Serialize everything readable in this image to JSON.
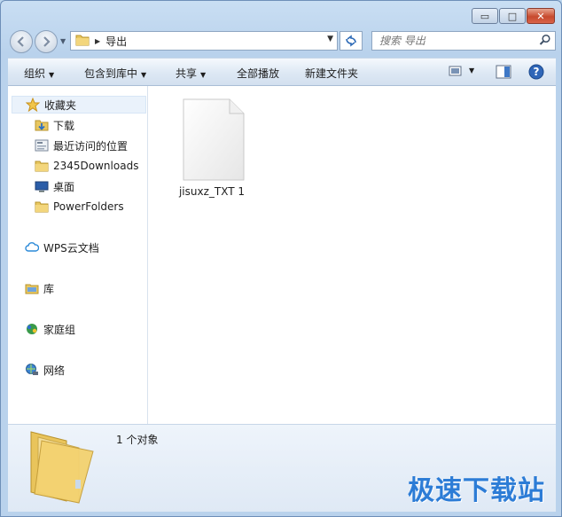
{
  "window": {
    "caption_buttons": {
      "minimize": "▭",
      "maximize": "□",
      "close": "✕"
    }
  },
  "nav": {
    "back_icon": "back-arrow-icon",
    "forward_icon": "forward-arrow-icon",
    "address": {
      "crumbs": [
        "导出"
      ]
    },
    "search": {
      "placeholder": "搜索 导出"
    }
  },
  "toolbar": {
    "organize": "组织",
    "include_in_library": "包含到库中",
    "share": "共享",
    "play_all": "全部播放",
    "new_folder": "新建文件夹"
  },
  "sidebar": {
    "favorites_label": "收藏夹",
    "favorites": [
      {
        "label": "下载",
        "icon": "download-folder-icon"
      },
      {
        "label": "最近访问的位置",
        "icon": "recent-places-icon"
      },
      {
        "label": "2345Downloads",
        "icon": "folder-icon"
      },
      {
        "label": "桌面",
        "icon": "desktop-icon"
      },
      {
        "label": "PowerFolders",
        "icon": "folder-icon"
      }
    ],
    "wps_cloud": "WPS云文档",
    "libraries": "库",
    "homegroup": "家庭组",
    "network": "网络"
  },
  "content": {
    "files": [
      {
        "name": "jisuxz_TXT 1",
        "icon": "blank-file-icon"
      }
    ]
  },
  "details": {
    "count_text": "1 个对象"
  },
  "watermark": "极速下载站",
  "colors": {
    "window_frame": "#b9d2ec",
    "accent": "#2c7cd6",
    "close_button": "#c74a2e"
  }
}
